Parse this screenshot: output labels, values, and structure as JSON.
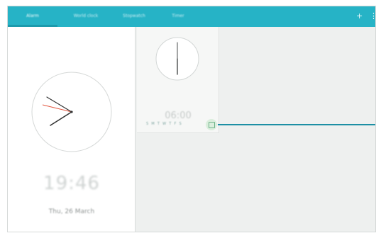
{
  "appbar": {
    "tabs": [
      {
        "label": "Alarm",
        "active": true
      },
      {
        "label": "World clock",
        "active": false
      },
      {
        "label": "Stopwatch",
        "active": false
      },
      {
        "label": "Timer",
        "active": false
      }
    ],
    "add_icon": "+",
    "more_icon": "⋮",
    "accent": "#26b3c6"
  },
  "current": {
    "time": "19:46",
    "date": "Thu, 26 March"
  },
  "alarm": {
    "time": "06:00",
    "days": "S M T W T F S",
    "toggle_icon": "checkbox-icon",
    "toggle_color": "#6fb48a"
  }
}
